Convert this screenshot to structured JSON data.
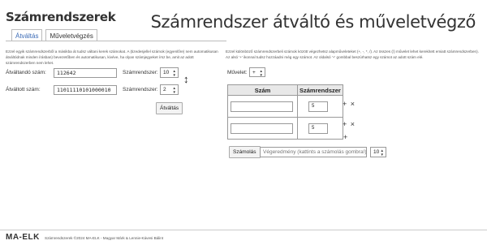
{
  "header": {
    "app_title": "Számrendszerek",
    "page_title": "Számrendszer átváltó és műveletvégző"
  },
  "tabs": [
    {
      "label": "Átváltás",
      "active": true
    },
    {
      "label": "Műveletvégzés",
      "active": false
    }
  ],
  "converter": {
    "description": "Ezzel egyik számrendszerből a másikba át tudsz váltani kerek számokat. A (tizedesjellel számok (egyenlőre) nem automatikusan átváltódnak minden írásban) bevezetőben és automatikusan, kivéve, ha olyan számjegyeket írsz be, amit az adott számrendszerben nem lehet.",
    "source_label": "Átváltandó szám:",
    "source_value": "112642",
    "source_base_label": "Számrendszer:",
    "source_base_value": "10",
    "result_label": "Átváltott szám:",
    "result_value": "11011110101000010",
    "result_base_label": "Számrendszer:",
    "result_base_value": "2",
    "swap_icon": "swap-vertical-icon",
    "convert_button": "Átváltás"
  },
  "operations": {
    "description": "Ezzel különböző számrendszerbeli számok között végezhetsz alapműveleteket (+, -, *, /). Az összes (/) művelet lehet kerekített emiatt számrendszerben). Az alsó '+' ikonnal tudsz hozzáadni még egy számot. Az oldalsó '+' gombbal beszúrhatsz egy számot az adott szám elé.",
    "operation_label": "Művelet:",
    "operation_value": "+",
    "table_headers": [
      "Szám",
      "Számrendszer"
    ],
    "rows": [
      {
        "number": "",
        "base": "5"
      },
      {
        "number": "",
        "base": "5"
      }
    ],
    "row_actions": "+ ×",
    "add_row": "+",
    "calc_button": "Számolás",
    "result_placeholder": "Végeredmény (kattints a számolás gombra!)",
    "result_base": "10"
  },
  "footer": {
    "logo": "MA-ELK",
    "text": "Számrendszerek ©2024 MA-ELK - Magyar Márk & Lennie-Kávesi Bálint"
  }
}
